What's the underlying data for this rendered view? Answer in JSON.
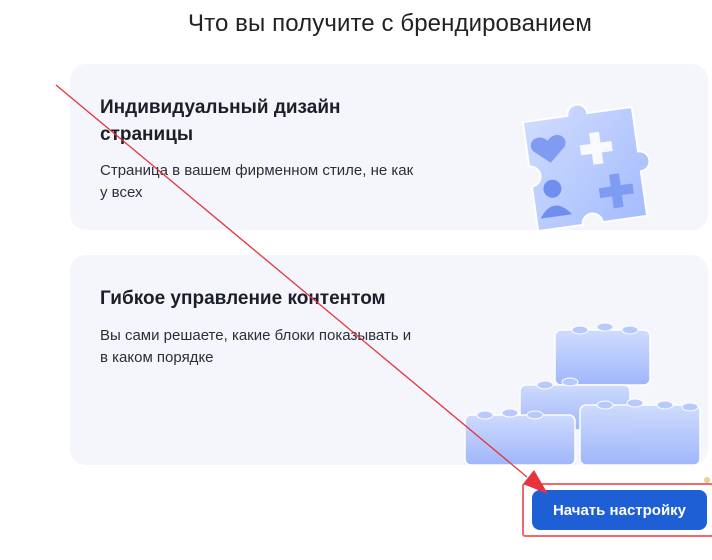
{
  "page": {
    "title": "Что вы получите с брендированием"
  },
  "cards": [
    {
      "title": "Индивидуальный дизайн страницы",
      "description": "Страница в вашем фирменном стиле, не как у всех",
      "illustration": "puzzle-icon"
    },
    {
      "title": "Гибкое управление контентом",
      "description": "Вы сами решаете, какие блоки показывать и в каком порядке",
      "illustration": "blocks-icon"
    }
  ],
  "actions": {
    "start_setup_label": "Начать настройку"
  },
  "annotation": {
    "arrow_color": "#e8323c",
    "highlight_color": "#f06a6a"
  },
  "colors": {
    "primary": "#1f5fd6",
    "card_background": "#f4f6fb"
  }
}
